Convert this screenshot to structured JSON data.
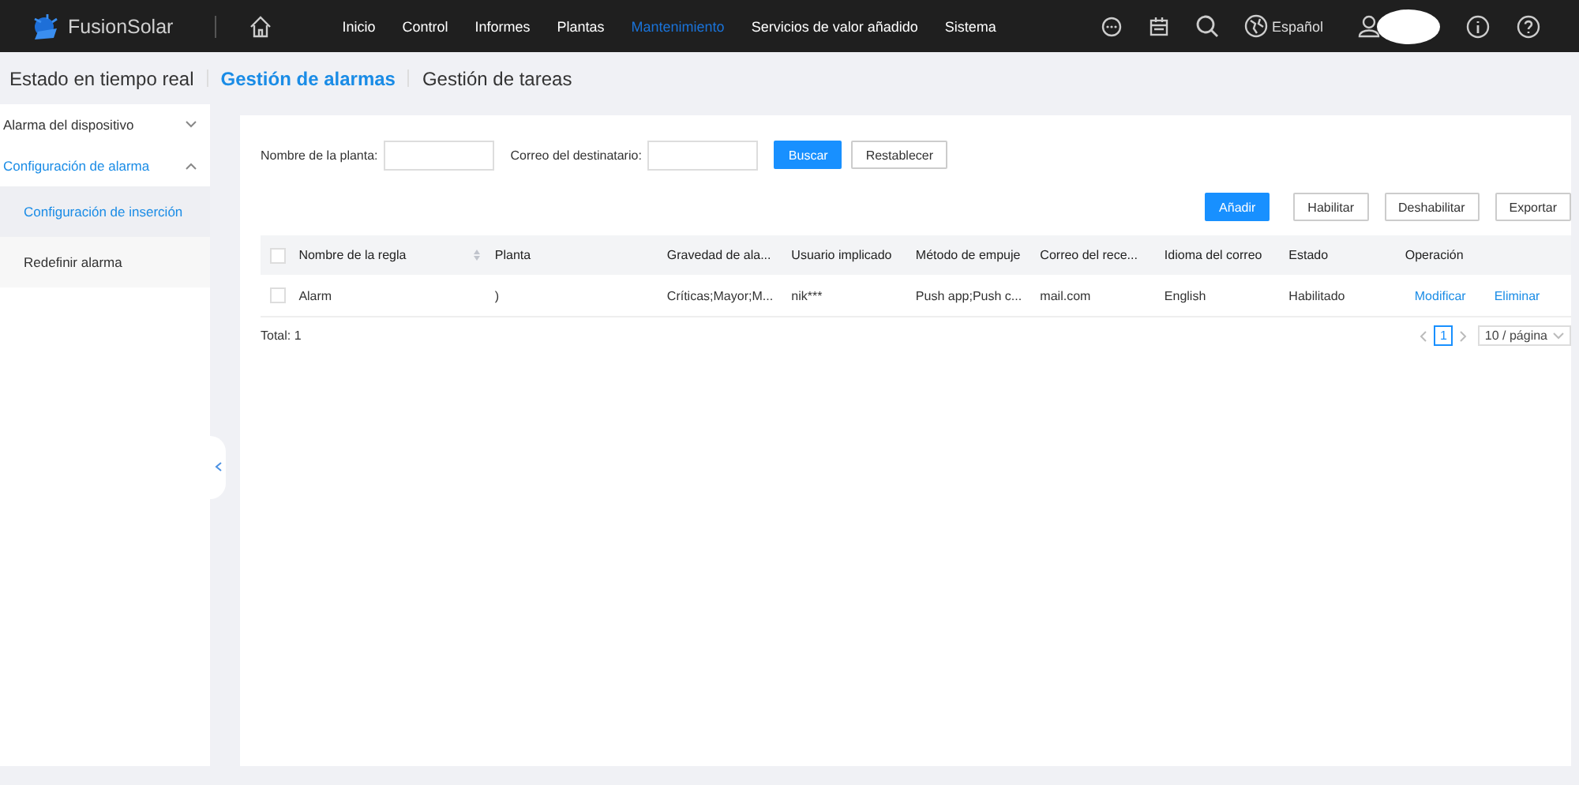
{
  "header": {
    "brand": "FusionSolar",
    "nav": [
      {
        "label": "Inicio",
        "selected": false
      },
      {
        "label": "Control",
        "selected": false
      },
      {
        "label": "Informes",
        "selected": false
      },
      {
        "label": "Plantas",
        "selected": false
      },
      {
        "label": "Mantenimiento",
        "selected": true
      },
      {
        "label": "Servicios de valor añadido",
        "selected": false
      },
      {
        "label": "Sistema",
        "selected": false
      }
    ],
    "language": "Español"
  },
  "tabs": [
    {
      "label": "Estado en tiempo real",
      "selected": false
    },
    {
      "label": "Gestión de alarmas",
      "selected": true
    },
    {
      "label": "Gestión de tareas",
      "selected": false
    }
  ],
  "sidebar": {
    "items": [
      {
        "label": "Alarma del dispositivo",
        "expanded": false,
        "selected": false
      },
      {
        "label": "Configuración de alarma",
        "expanded": true,
        "selected": true,
        "children": [
          {
            "label": "Configuración de inserción",
            "selected": true
          },
          {
            "label": "Redefinir alarma",
            "selected": false
          }
        ]
      }
    ]
  },
  "filters": [
    {
      "label": "Nombre de la planta:"
    },
    {
      "label": "Correo del destinatario:"
    }
  ],
  "filter_buttons": [
    {
      "label": "Buscar",
      "kind": "primary"
    },
    {
      "label": "Restablecer",
      "kind": "default"
    }
  ],
  "actions": [
    {
      "label": "Añadir",
      "kind": "primary"
    },
    {
      "label": "Habilitar",
      "kind": "default"
    },
    {
      "label": "Deshabilitar",
      "kind": "default"
    },
    {
      "label": "Exportar",
      "kind": "default"
    }
  ],
  "table": {
    "header_checked": false,
    "columns": [
      {
        "label": "Nombre de la regla",
        "sortable": true
      },
      {
        "label": "Planta",
        "sortable": false
      },
      {
        "label": "Gravedad de ala...",
        "sortable": false
      },
      {
        "label": "Usuario implicado",
        "sortable": false
      },
      {
        "label": "Método de empuje",
        "sortable": false
      },
      {
        "label": "Correo del rece...",
        "sortable": false
      },
      {
        "label": "Idioma del correo",
        "sortable": false
      },
      {
        "label": "Estado",
        "sortable": false
      },
      {
        "label": "Operación",
        "sortable": false
      }
    ],
    "rows": [
      {
        "checked": false,
        "cells": [
          "Alarm",
          ")",
          "Críticas;Mayor;M...",
          "nik***",
          "Push app;Push c...",
          "mail.com",
          "English",
          "Habilitado"
        ],
        "operations": [
          "Modificar",
          "Eliminar"
        ]
      }
    ]
  },
  "total": "Total: 1",
  "pagination": {
    "pages": [
      {
        "label": "1",
        "selected": true
      }
    ],
    "page_size": "10 / página"
  }
}
